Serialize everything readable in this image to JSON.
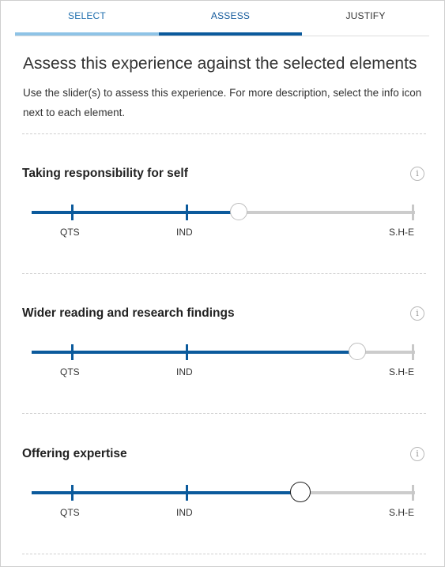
{
  "tabs": [
    {
      "label": "SELECT"
    },
    {
      "label": "ASSESS"
    },
    {
      "label": "JUSTIFY"
    }
  ],
  "heading": "Assess this experience against the selected elements",
  "description": "Use the slider(s) to assess this experience. For more description, select the info icon next to each element.",
  "info_symbol": "i",
  "elements": [
    {
      "title": "Taking responsibility for self",
      "value": 0.54,
      "marks": [
        "QTS",
        "IND",
        "S.H-E"
      ]
    },
    {
      "title": "Wider reading and research findings",
      "value": 0.85,
      "marks": [
        "QTS",
        "IND",
        "S.H-E"
      ]
    },
    {
      "title": "Offering expertise",
      "value": 0.7,
      "marks": [
        "QTS",
        "IND",
        "S.H-E"
      ]
    }
  ],
  "colors": {
    "accent": "#0b5a9c",
    "rail": "#cccccc",
    "select_tab_bar": "#8ec3e6"
  }
}
